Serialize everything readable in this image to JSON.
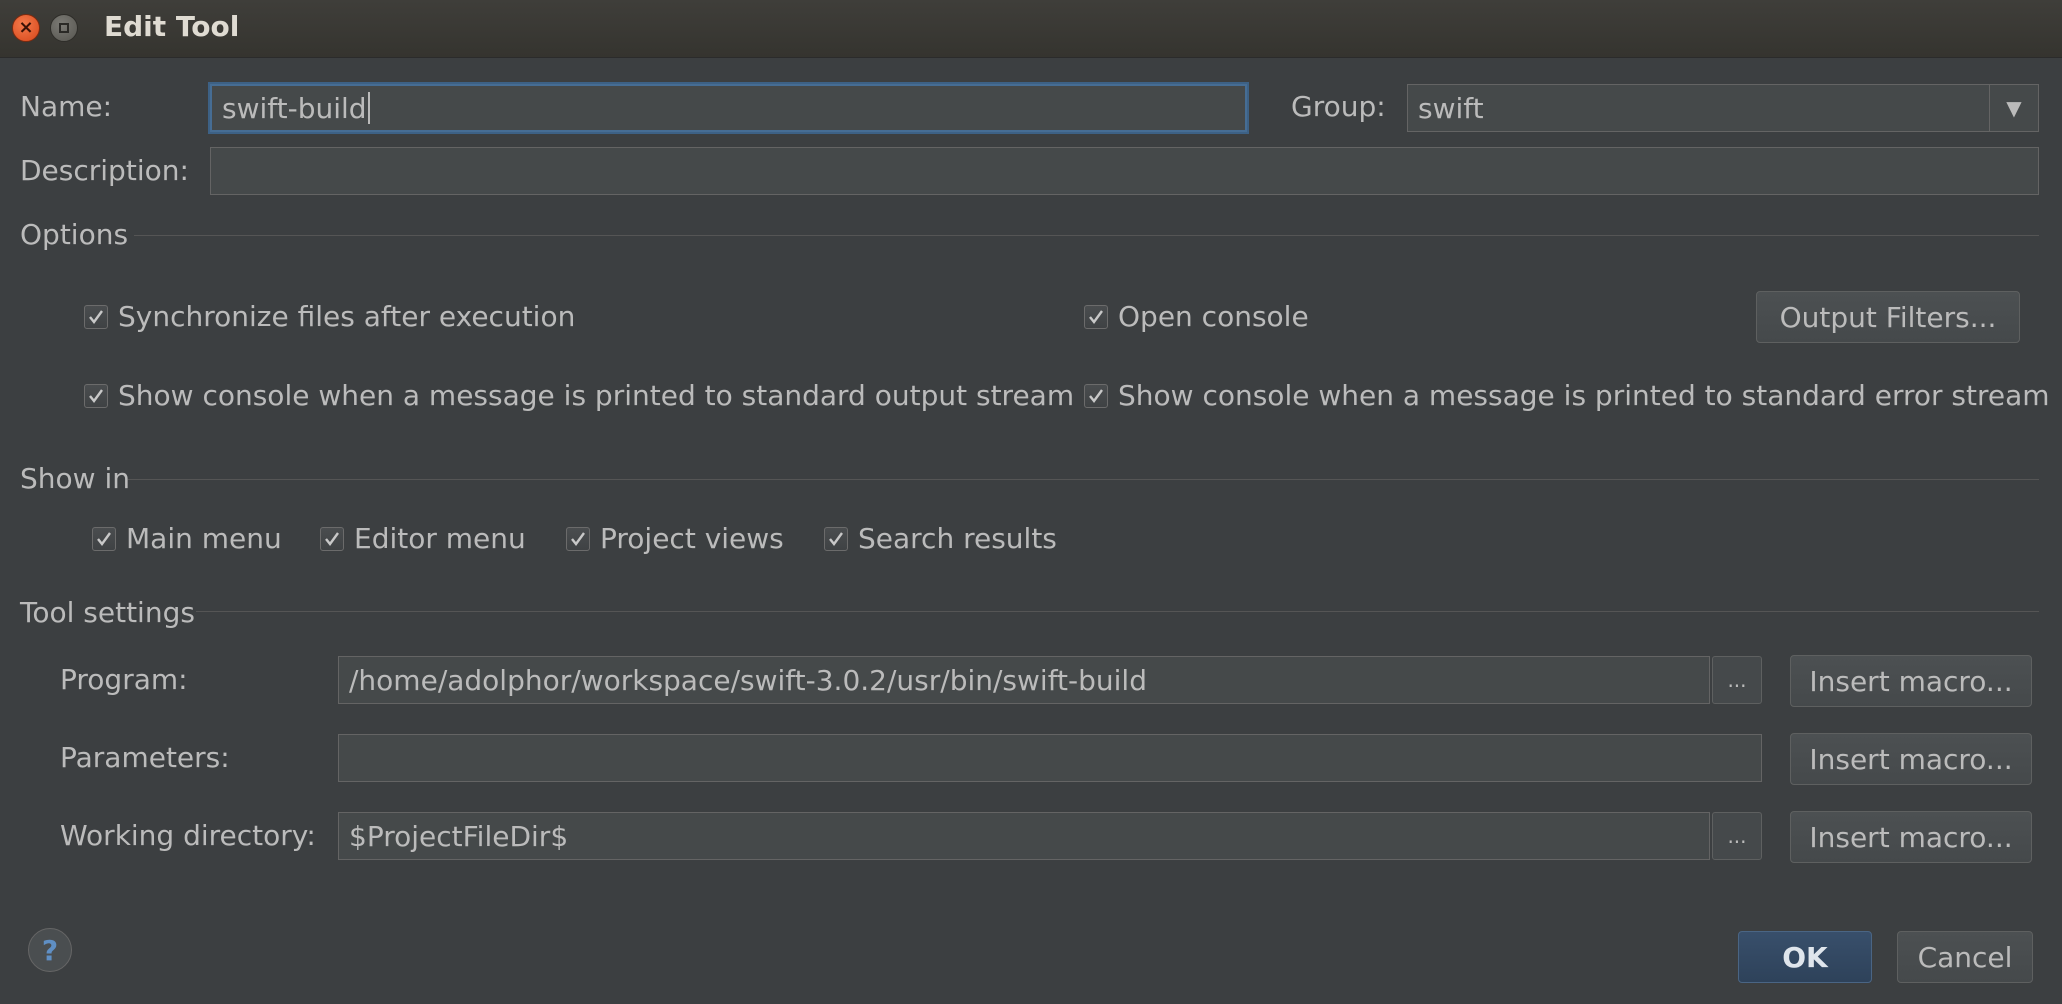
{
  "window": {
    "title": "Edit Tool",
    "close_symbol": "×"
  },
  "name": {
    "label": "Name:",
    "value": "swift-build"
  },
  "group": {
    "label": "Group:",
    "value": "swift",
    "arrow": "▼"
  },
  "description": {
    "label": "Description:",
    "value": ""
  },
  "options": {
    "title": "Options",
    "sync_files": {
      "label": "Synchronize files after execution",
      "checked": true
    },
    "open_console": {
      "label": "Open console",
      "checked": true
    },
    "output_filters_label": "Output Filters...",
    "show_console_stdout": {
      "label": "Show console when a message is printed to standard output stream",
      "checked": true
    },
    "show_console_stderr": {
      "label": "Show console when a message is printed to standard error stream",
      "checked": true
    }
  },
  "show_in": {
    "title": "Show in",
    "items": [
      {
        "label": "Main menu",
        "checked": true
      },
      {
        "label": "Editor menu",
        "checked": true
      },
      {
        "label": "Project views",
        "checked": true
      },
      {
        "label": "Search results",
        "checked": true
      }
    ]
  },
  "tool_settings": {
    "title": "Tool settings",
    "program": {
      "label": "Program:",
      "value": "/home/adolphor/workspace/swift-3.0.2/usr/bin/swift-build"
    },
    "parameters": {
      "label": "Parameters:",
      "value": ""
    },
    "working_directory": {
      "label": "Working directory:",
      "value": "$ProjectFileDir$"
    },
    "browse_label": "...",
    "insert_macro_label": "Insert macro..."
  },
  "footer": {
    "help_symbol": "?",
    "ok_label": "OK",
    "cancel_label": "Cancel"
  },
  "colors": {
    "background": "#3c3f41",
    "field": "#45494a",
    "focus": "#466d94",
    "primary": "#2e425a"
  }
}
